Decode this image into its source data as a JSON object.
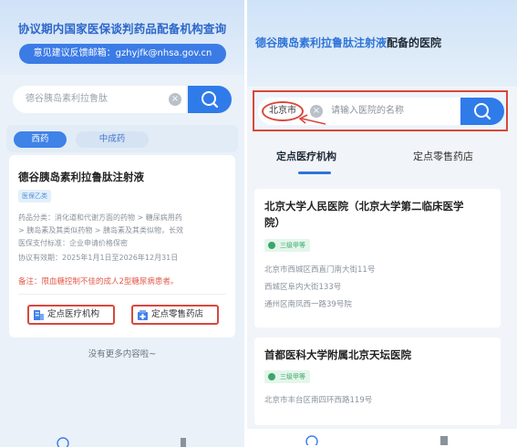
{
  "left": {
    "header": {
      "title": "协议期内国家医保谈判药品配备机构查询",
      "feedback": "意见建议反馈邮箱：gzhyjfk@nhsa.gov.cn"
    },
    "search": {
      "value": "德谷胰岛素利拉鲁肽"
    },
    "tabs": [
      {
        "label": "西药",
        "active": true
      },
      {
        "label": "中成药",
        "active": false
      }
    ],
    "drug": {
      "name": "德谷胰岛素利拉鲁肽注射液",
      "badge": "医保乙类",
      "category_line1": "药品分类：消化道和代谢方面的药物 > 糖尿病用药",
      "category_line2": "> 胰岛素及其类似药物 > 胰岛素及其类似物，长效",
      "standard": "医保支付标准：企业申请价格保密",
      "validity": "协议有效期：2025年1月1日至2026年12月31日",
      "note": "备注：限血糖控制不佳的成人2型糖尿病患者。",
      "btn_institution": "定点医疗机构",
      "btn_pharmacy": "定点零售药店"
    },
    "no_more": "没有更多内容啦~"
  },
  "right": {
    "title_highlight": "德谷胰岛素利拉鲁肽注射液",
    "title_rest": "配备的医院",
    "search": {
      "city": "北京市",
      "placeholder": "请输入医院的名称"
    },
    "tabs": [
      {
        "label": "定点医疗机构",
        "active": true
      },
      {
        "label": "定点零售药店",
        "active": false
      }
    ],
    "hospitals": [
      {
        "name_line1": "北京大学人民医院（北京大学第二临床医学",
        "name_line2": "院）",
        "level": "三级甲等",
        "addresses": [
          "北京市西城区西直门南大街11号",
          "西城区阜内大街133号",
          "通州区南凤西一路39号院"
        ]
      },
      {
        "name_line1": "首都医科大学附属北京天坛医院",
        "level": "三级甲等",
        "addresses": [
          "北京市丰台区南四环西路119号"
        ]
      }
    ]
  },
  "colors": {
    "primary_blue": "#2f7bea",
    "title_blue": "#2c67c9",
    "annotation_red": "#d9473c",
    "note_red": "#e35a4a",
    "level_green": "#3aa66c"
  },
  "icons": [
    "search-icon",
    "clear-icon",
    "hospital-icon",
    "pharmacy-icon",
    "arrow-annotation"
  ]
}
